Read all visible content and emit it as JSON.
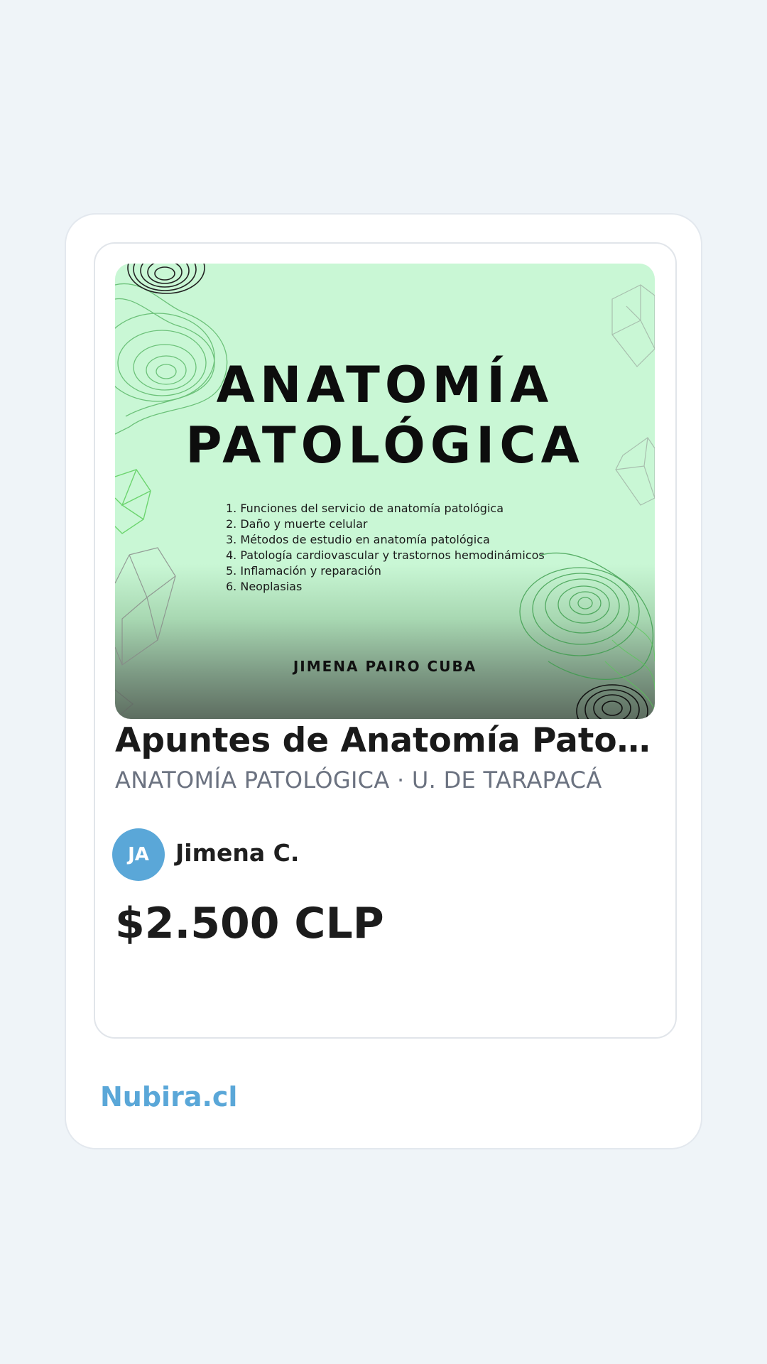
{
  "listing": {
    "cover": {
      "title_line1": "ANATOMÍA",
      "title_line2": "PATOLÓGICA",
      "topics": [
        "1. Funciones del servicio de anatomía patológica",
        "2. Daño y muerte celular",
        "3. Métodos de estudio en anatomía patológica",
        "4. Patología cardiovascular y trastornos hemodinámicos",
        "5. Inflamación y reparación",
        "6. Neoplasias"
      ],
      "author": "JIMENA PAIRO CUBA"
    },
    "title": "Apuntes de Anatomía Patológica",
    "subtitle": "ANATOMÍA PATOLÓGICA · U. DE TARAPACÁ",
    "seller": {
      "initials": "JA",
      "name": "Jimena C."
    },
    "price": "$2.500 CLP"
  },
  "brand": "Nubira.cl",
  "colors": {
    "background": "#eff4f8",
    "accent": "#5aa7d8",
    "cover_green": "#c9f7d5"
  }
}
